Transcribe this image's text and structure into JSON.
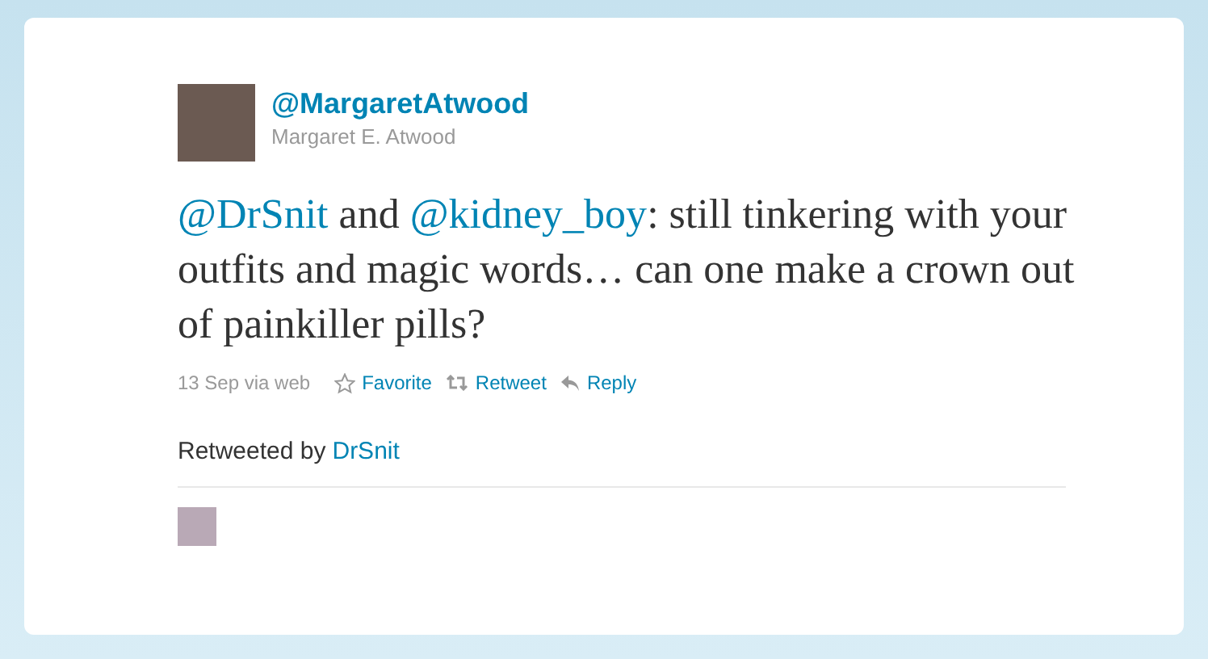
{
  "author": {
    "handle": "@MargaretAtwood",
    "name": "Margaret E. Atwood"
  },
  "tweet": [
    {
      "kind": "mention",
      "text": "@DrSnit"
    },
    {
      "kind": "text",
      "text": " and "
    },
    {
      "kind": "mention",
      "text": "@kidney_boy"
    },
    {
      "kind": "text",
      "text": ": still tinkering with your outfits and magic words… can one make a crown out of painkiller pills?"
    }
  ],
  "meta": {
    "time": "13 Sep via web"
  },
  "actions": [
    {
      "kind": "favorite",
      "label": "Favorite"
    },
    {
      "kind": "retweet",
      "label": "Retweet"
    },
    {
      "kind": "reply",
      "label": "Reply"
    }
  ],
  "retweeted": {
    "label": "Retweeted by",
    "user": "DrSnit"
  }
}
